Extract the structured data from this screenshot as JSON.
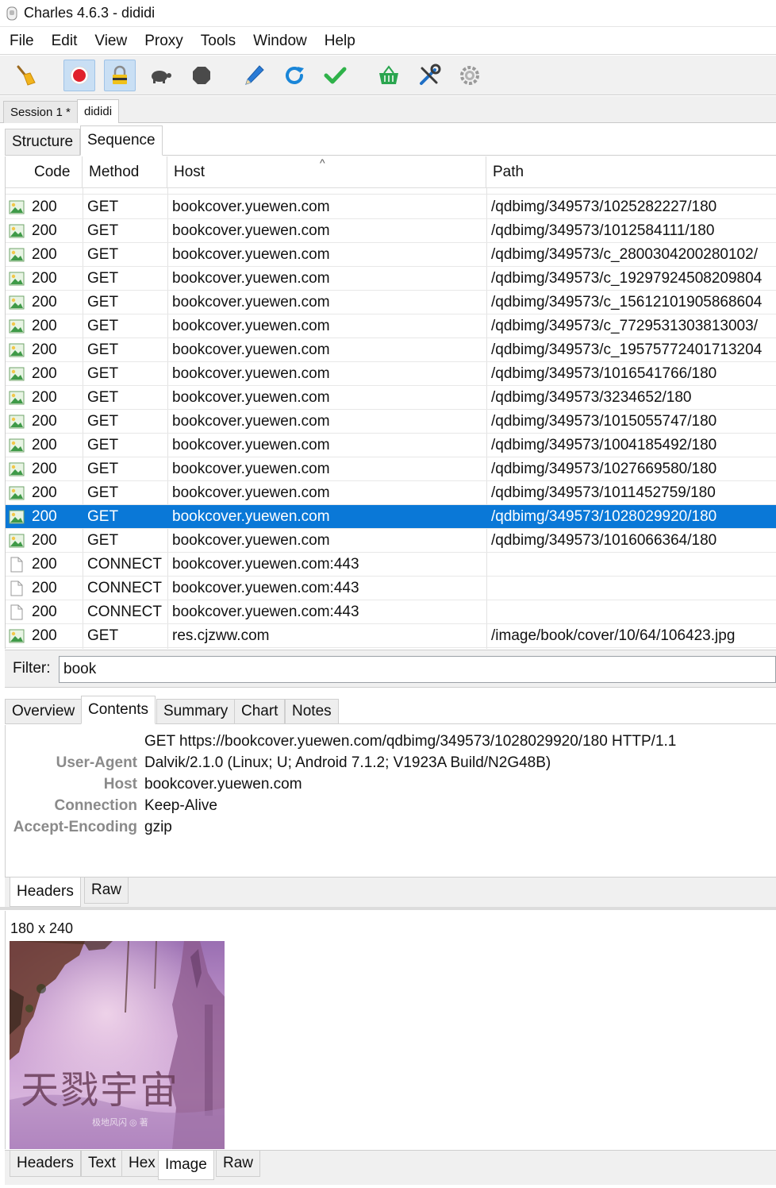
{
  "window": {
    "title": "Charles 4.6.3 - dididi"
  },
  "menu": [
    "File",
    "Edit",
    "View",
    "Proxy",
    "Tools",
    "Window",
    "Help"
  ],
  "toolbar": {
    "icons": [
      "broom-icon",
      "record-icon",
      "ssl-proxying-icon",
      "throttle-turtle-icon",
      "breakpoints-icon",
      "compose-pen-icon",
      "repeat-icon",
      "validate-check-icon",
      "basket-icon",
      "tools-icon",
      "settings-gear-icon"
    ],
    "colors": {
      "record": "#e0212b",
      "pen": "#2a7bd6",
      "repeat": "#1a86d8",
      "check": "#2fb24a",
      "basket": "#2aa54f",
      "selected_row": "#0a78d7"
    }
  },
  "sessions": {
    "tab1": "Session 1 *",
    "tab2": "dididi"
  },
  "view_tabs": {
    "structure": "Structure",
    "sequence": "Sequence"
  },
  "table": {
    "columns": {
      "code": "Code",
      "method": "Method",
      "host": "Host",
      "path": "Path"
    },
    "rows": [
      {
        "type": "image",
        "code": "200",
        "method": "GET",
        "host": "bookcover.yuewen.com",
        "path": "/qdbimg/349573/1025282227/180"
      },
      {
        "type": "image",
        "code": "200",
        "method": "GET",
        "host": "bookcover.yuewen.com",
        "path": "/qdbimg/349573/1012584111/180"
      },
      {
        "type": "image",
        "code": "200",
        "method": "GET",
        "host": "bookcover.yuewen.com",
        "path": "/qdbimg/349573/c_2800304200280102/"
      },
      {
        "type": "image",
        "code": "200",
        "method": "GET",
        "host": "bookcover.yuewen.com",
        "path": "/qdbimg/349573/c_19297924508209804"
      },
      {
        "type": "image",
        "code": "200",
        "method": "GET",
        "host": "bookcover.yuewen.com",
        "path": "/qdbimg/349573/c_15612101905868604"
      },
      {
        "type": "image",
        "code": "200",
        "method": "GET",
        "host": "bookcover.yuewen.com",
        "path": "/qdbimg/349573/c_7729531303813003/"
      },
      {
        "type": "image",
        "code": "200",
        "method": "GET",
        "host": "bookcover.yuewen.com",
        "path": "/qdbimg/349573/c_19575772401713204"
      },
      {
        "type": "image",
        "code": "200",
        "method": "GET",
        "host": "bookcover.yuewen.com",
        "path": "/qdbimg/349573/1016541766/180"
      },
      {
        "type": "image",
        "code": "200",
        "method": "GET",
        "host": "bookcover.yuewen.com",
        "path": "/qdbimg/349573/3234652/180"
      },
      {
        "type": "image",
        "code": "200",
        "method": "GET",
        "host": "bookcover.yuewen.com",
        "path": "/qdbimg/349573/1015055747/180"
      },
      {
        "type": "image",
        "code": "200",
        "method": "GET",
        "host": "bookcover.yuewen.com",
        "path": "/qdbimg/349573/1004185492/180"
      },
      {
        "type": "image",
        "code": "200",
        "method": "GET",
        "host": "bookcover.yuewen.com",
        "path": "/qdbimg/349573/1027669580/180"
      },
      {
        "type": "image",
        "code": "200",
        "method": "GET",
        "host": "bookcover.yuewen.com",
        "path": "/qdbimg/349573/1011452759/180"
      },
      {
        "type": "image",
        "code": "200",
        "method": "GET",
        "host": "bookcover.yuewen.com",
        "path": "/qdbimg/349573/1028029920/180",
        "selected": true
      },
      {
        "type": "image",
        "code": "200",
        "method": "GET",
        "host": "bookcover.yuewen.com",
        "path": "/qdbimg/349573/1016066364/180"
      },
      {
        "type": "blank",
        "code": "200",
        "method": "CONNECT",
        "host": "bookcover.yuewen.com:443",
        "path": ""
      },
      {
        "type": "blank",
        "code": "200",
        "method": "CONNECT",
        "host": "bookcover.yuewen.com:443",
        "path": ""
      },
      {
        "type": "blank",
        "code": "200",
        "method": "CONNECT",
        "host": "bookcover.yuewen.com:443",
        "path": ""
      },
      {
        "type": "image",
        "code": "200",
        "method": "GET",
        "host": "res.cjzww.com",
        "path": "/image/book/cover/10/64/106423.jpg"
      }
    ]
  },
  "filter": {
    "label": "Filter:",
    "value": "book"
  },
  "detail_tabs": {
    "overview": "Overview",
    "contents": "Contents",
    "summary": "Summary",
    "chart": "Chart",
    "notes": "Notes"
  },
  "request": {
    "line": "GET https://bookcover.yuewen.com/qdbimg/349573/1028029920/180 HTTP/1.1",
    "headers": [
      {
        "name": "User-Agent",
        "value": "Dalvik/2.1.0 (Linux; U; Android 7.1.2; V1923A Build/N2G48B)"
      },
      {
        "name": "Host",
        "value": "bookcover.yuewen.com"
      },
      {
        "name": "Connection",
        "value": "Keep-Alive"
      },
      {
        "name": "Accept-Encoding",
        "value": "gzip"
      }
    ]
  },
  "request_tabs": {
    "headers": "Headers",
    "raw": "Raw"
  },
  "response": {
    "dimensions": "180 x 240",
    "cover_title": "天戮宇宙",
    "cover_author": "极地风闪 ◎ 著"
  },
  "response_tabs": {
    "headers": "Headers",
    "text": "Text",
    "hex": "Hex",
    "image": "Image",
    "raw": "Raw"
  }
}
